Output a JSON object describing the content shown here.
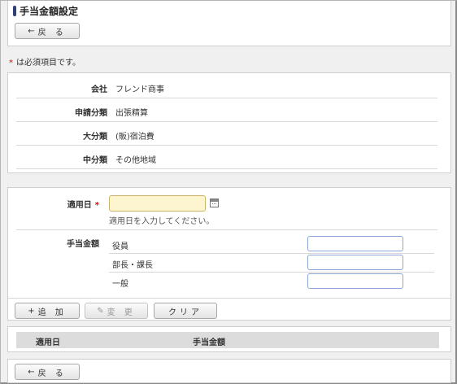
{
  "page": {
    "title": "手当金額設定"
  },
  "buttons": {
    "back_icon": "←",
    "back_label": "戻 る",
    "add_icon": "+",
    "add_label": "追 加",
    "edit_icon": "✎",
    "edit_label": "変 更",
    "clear_label": "クリア"
  },
  "required_note": {
    "asterisk": "*",
    "text": "は必須項目です。"
  },
  "info": {
    "rows": [
      {
        "label": "会社",
        "value": "フレンド商事"
      },
      {
        "label": "申請分類",
        "value": "出張精算"
      },
      {
        "label": "大分類",
        "value": "(販)宿泊費"
      },
      {
        "label": "中分類",
        "value": "その他地域"
      }
    ]
  },
  "form": {
    "date_label": "適用日",
    "date_required": "*",
    "date_value": "",
    "date_hint": "適用日を入力してください。",
    "amount_label": "手当金額",
    "amount_rows": [
      {
        "label": "役員",
        "value": ""
      },
      {
        "label": "部長・課長",
        "value": ""
      },
      {
        "label": "一般",
        "value": ""
      }
    ]
  },
  "list": {
    "columns": [
      "適用日",
      "手当金額"
    ]
  },
  "colors": {
    "title_mark": "#2f3f7a",
    "required": "#dd0000",
    "date_input_bg": "#fdf5cf",
    "amount_input_border": "#8aa7d6"
  }
}
